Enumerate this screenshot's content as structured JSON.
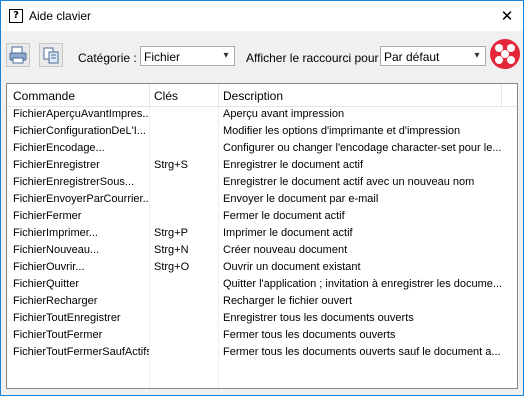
{
  "window": {
    "title": "Aide clavier",
    "title_icon": "help-icon",
    "close_label": "✕"
  },
  "toolbar": {
    "category_label": "Catégorie :",
    "category_value": "Fichier",
    "shortcut_label": "Afficher le raccourci pour :",
    "shortcut_value": "Par défaut",
    "icons": [
      "print-icon",
      "copy-icon",
      "altova-logo-icon"
    ]
  },
  "table": {
    "headers": [
      "Commande",
      "Clés",
      "Description"
    ],
    "rows": [
      [
        "FichierAperçuAvantImpres...",
        "",
        "Aperçu avant impression"
      ],
      [
        "FichierConfigurationDeL'I...",
        "",
        "Modifier les options d'imprimante et d'impression"
      ],
      [
        "FichierEncodage...",
        "",
        "Configurer ou changer l'encodage character-set pour le..."
      ],
      [
        "FichierEnregistrer",
        "Strg+S",
        "Enregistrer le document actif"
      ],
      [
        "FichierEnregistrerSous...",
        "",
        "Enregistrer le document actif avec un nouveau nom"
      ],
      [
        "FichierEnvoyerParCourrier...",
        "",
        "Envoyer le document par e-mail"
      ],
      [
        "FichierFermer",
        "",
        "Fermer le document actif"
      ],
      [
        "FichierImprimer...",
        "Strg+P",
        "Imprimer le document actif"
      ],
      [
        "FichierNouveau...",
        "Strg+N",
        "Créer nouveau document"
      ],
      [
        "FichierOuvrir...",
        "Strg+O",
        "Ouvrir un document existant"
      ],
      [
        "FichierQuitter",
        "",
        "Quitter l'application ; invitation à enregistrer les docume..."
      ],
      [
        "FichierRecharger",
        "",
        "Recharger le fichier ouvert"
      ],
      [
        "FichierToutEnregistrer",
        "",
        "Enregistrer tous les documents ouverts"
      ],
      [
        "FichierToutFermer",
        "",
        "Fermer tous les documents ouverts"
      ],
      [
        "FichierToutFermerSaufActifs",
        "",
        "Fermer tous les documents ouverts sauf le document a..."
      ]
    ]
  },
  "colors": {
    "accent": "#1883d7",
    "logo": "#e3263a"
  }
}
